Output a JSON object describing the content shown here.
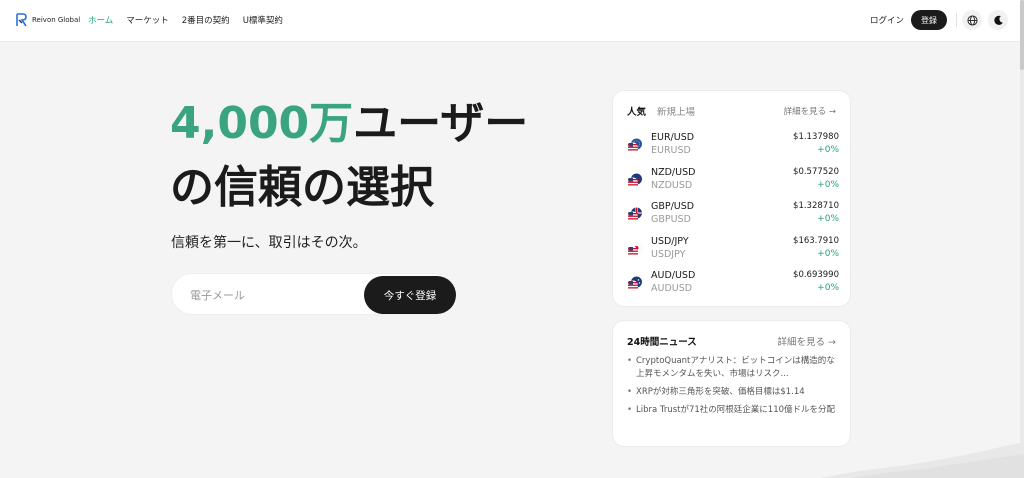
{
  "header": {
    "brand": "Reivon Global",
    "nav": [
      {
        "label": "ホーム",
        "active": true
      },
      {
        "label": "マーケット",
        "active": false
      },
      {
        "label": "2番目の契約",
        "active": false
      },
      {
        "label": "U標準契約",
        "active": false
      }
    ],
    "login_label": "ログイン",
    "register_label": "登録",
    "icons": [
      "globe-icon",
      "moon-icon"
    ]
  },
  "hero": {
    "accent": "4,000万",
    "title_rest": "ユーザー",
    "title_line2": "の信頼の選択",
    "subtitle": "信頼を第一に、取引はその次。",
    "email_placeholder": "電子メール",
    "cta_label": "今すぐ登録"
  },
  "market": {
    "tabs": [
      {
        "label": "人気",
        "active": true
      },
      {
        "label": "新規上場",
        "active": false
      }
    ],
    "more_label": "詳細を見る →",
    "rows": [
      {
        "pair": "EUR/USD",
        "symbol": "EURUSD",
        "price": "$1.137980",
        "change": "+0%",
        "flag": "eu-us"
      },
      {
        "pair": "NZD/USD",
        "symbol": "NZDUSD",
        "price": "$0.577520",
        "change": "+0%",
        "flag": "nz-us"
      },
      {
        "pair": "GBP/USD",
        "symbol": "GBPUSD",
        "price": "$1.328710",
        "change": "+0%",
        "flag": "gb-us"
      },
      {
        "pair": "USD/JPY",
        "symbol": "USDJPY",
        "price": "$163.7910",
        "change": "+0%",
        "flag": "us-jp"
      },
      {
        "pair": "AUD/USD",
        "symbol": "AUDUSD",
        "price": "$0.693990",
        "change": "+0%",
        "flag": "au-us"
      }
    ]
  },
  "news": {
    "title": "24時間ニュース",
    "more_label": "詳細を見る →",
    "items": [
      "CryptoQuantアナリスト：ビットコインは構造的な上昇モメンタムを失い、市場はリスク...",
      "XRPが対称三角形を突破、価格目標は$1.14",
      "Libra Trustが71社の阿根廷企業に110億ドルを分配"
    ]
  },
  "colors": {
    "accent": "#3aa37f",
    "positive": "#26a17b",
    "dark_button": "#1b1b1b",
    "background": "#f4f4f4"
  }
}
